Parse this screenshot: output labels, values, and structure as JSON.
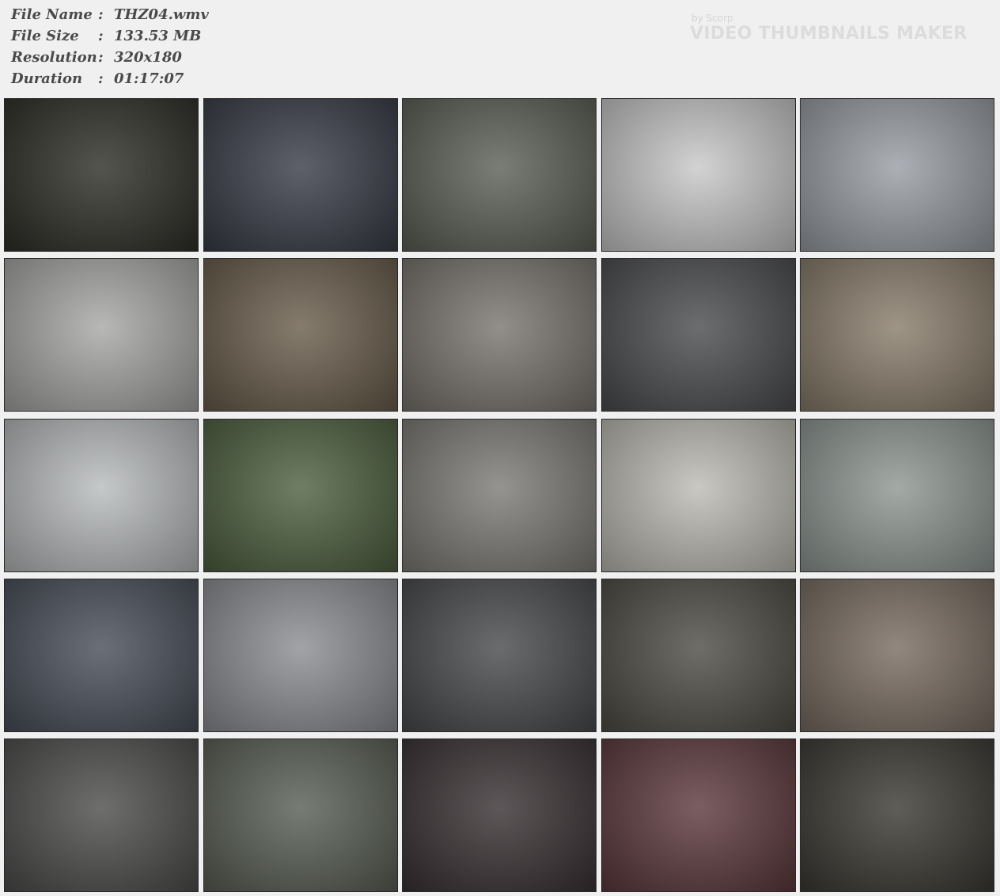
{
  "file_info": {
    "name_label": "File Name",
    "name_value": "THZ04.wmv",
    "size_label": "File Size",
    "size_value": "133.53 MB",
    "resolution_label": "Resolution",
    "resolution_value": "320x180",
    "duration_label": "Duration",
    "duration_value": "01:17:07",
    "separator": ":"
  },
  "watermark": {
    "by": "by Scorp",
    "title": "VIDEO THUMBNAILS MAKER"
  },
  "grid": {
    "columns": 5,
    "rows": 5,
    "thumb_colors": [
      [
        "#2e2f28",
        "#3a3d49",
        "#5c6156",
        "#c9c9c9",
        "#9a9ea4"
      ],
      [
        "#a8a9a6",
        "#6b5e4d",
        "#7a7670",
        "#4c4d4f",
        "#8a7d6c"
      ],
      [
        "#b9bcbd",
        "#4f6141",
        "#7d7c78",
        "#bdbcb4",
        "#8f9893"
      ],
      [
        "#4a4f5a",
        "#8d8f94",
        "#4a4b4e",
        "#4f4d45",
        "#7a6d62"
      ],
      [
        "#4e4f4d",
        "#5a6055",
        "#3a3234",
        "#5e3a3e",
        "#3c3a34"
      ]
    ]
  }
}
